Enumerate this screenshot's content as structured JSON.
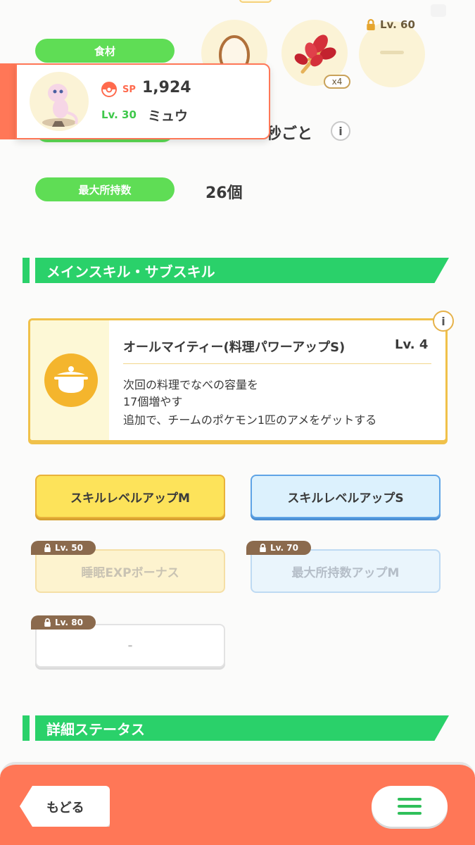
{
  "ingredients": {
    "label": "食材",
    "slot2_count": "x4",
    "slot3_lock": "Lv. 60",
    "slot3_value": "—"
  },
  "pokemon": {
    "sp_label": "SP",
    "sp_value": "1,924",
    "level": "Lv. 30",
    "name": "ミュウ"
  },
  "stats": {
    "frequency_suffix": "秒ごと",
    "max_carry_label": "最大所持数",
    "max_carry_value": "26個"
  },
  "skills_section": {
    "title": "メインスキル・サブスキル",
    "main_skill": {
      "name": "オールマイティー(料理パワーアップS)",
      "level": "Lv. 4",
      "desc_line1": "次回の料理でなべの容量を",
      "desc_line2": "17個増やす",
      "desc_line3": "追加で、チームのポケモン1匹のアメをゲットする"
    },
    "subskills": [
      {
        "label": "スキルレベルアップM",
        "lock": ""
      },
      {
        "label": "スキルレベルアップS",
        "lock": ""
      },
      {
        "label": "睡眠EXPボーナス",
        "lock": "Lv. 50"
      },
      {
        "label": "最大所持数アップM",
        "lock": "Lv. 70"
      },
      {
        "label": "-",
        "lock": "Lv. 80"
      }
    ]
  },
  "details_section": {
    "title": "詳細ステータス"
  },
  "footer": {
    "back_label": "もどる"
  },
  "colors": {
    "accent_green": "#2ad16a",
    "pill_green": "#5fdd55",
    "footer_orange": "#ff7757",
    "skill_yellow": "#fde35a",
    "skill_blue": "#dcf1fd"
  }
}
